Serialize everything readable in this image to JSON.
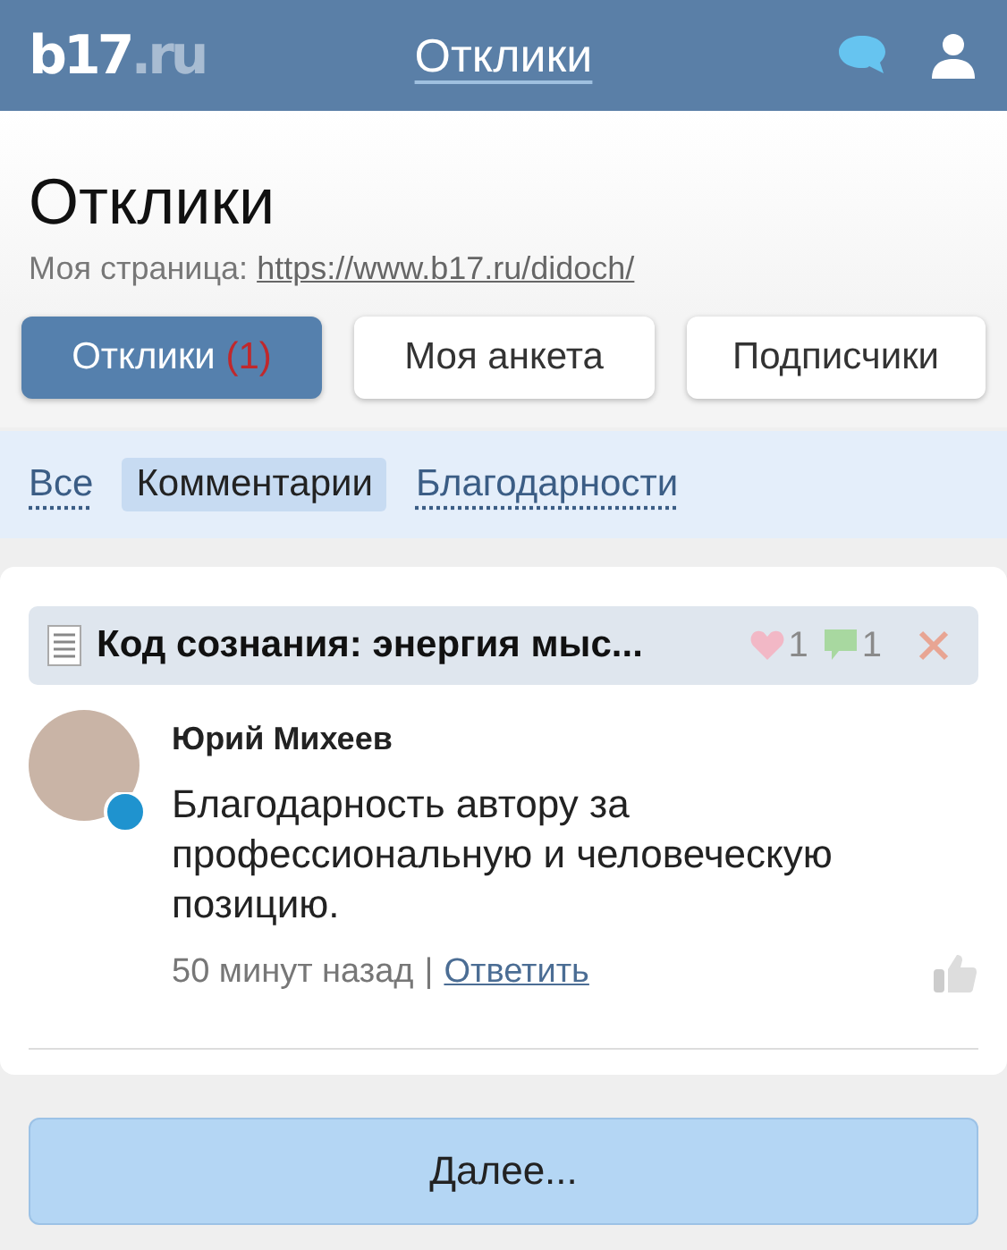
{
  "header": {
    "logo_main": "b17",
    "logo_suffix": ".ru",
    "title": "Отклики"
  },
  "page": {
    "title": "Отклики",
    "my_page_label": "Моя страница:",
    "my_page_link": "https://www.b17.ru/didoch/"
  },
  "tabs": [
    {
      "label": "Отклики",
      "count": "(1)",
      "selected": true
    },
    {
      "label": "Моя анкета",
      "selected": false
    },
    {
      "label": "Подписчики",
      "selected": false
    }
  ],
  "filters": [
    {
      "label": "Все",
      "selected": false
    },
    {
      "label": "Комментарии",
      "selected": true
    },
    {
      "label": "Благодарности",
      "selected": false
    }
  ],
  "responses": [
    {
      "article_title": "Код сознания: энергия мыс...",
      "likes": "1",
      "comments": "1",
      "author": "Юрий Михеев",
      "text": "Благодарность автору за профессиональную и человеческую позицию.",
      "time": "50 минут назад",
      "separator": "|",
      "reply": "Ответить"
    }
  ],
  "more_button": "Далее..."
}
